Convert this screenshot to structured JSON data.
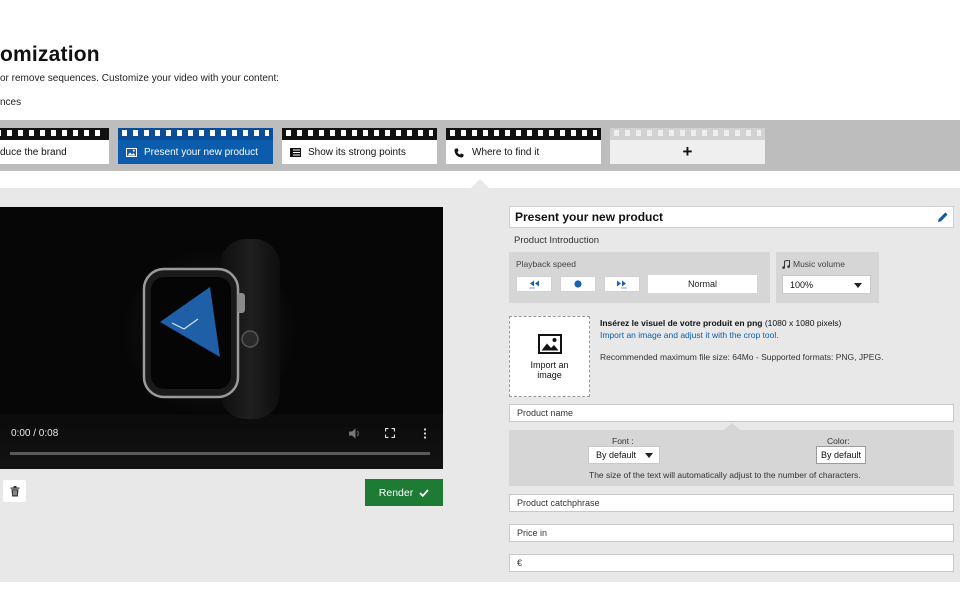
{
  "header": {
    "title": "omization",
    "subtitle": "or remove sequences. Customize your video with your content:",
    "section_label": "nces"
  },
  "sequences": [
    {
      "label": "duce the brand",
      "icon": "none",
      "active": false
    },
    {
      "label": "Present your new product",
      "icon": "image-icon",
      "active": true
    },
    {
      "label": "Show its strong points",
      "icon": "list-icon",
      "active": false
    },
    {
      "label": "Where to find it",
      "icon": "phone-icon",
      "active": false
    }
  ],
  "add_sequence": {
    "label": "+"
  },
  "video": {
    "time": "0:00 / 0:08",
    "render_label": "Render"
  },
  "panel": {
    "title": "Present your new product",
    "intro_label": "Product Introduction",
    "playback_speed_label": "Playback speed",
    "playback_speed_value": "Normal",
    "music_volume_label": "Music volume",
    "music_volume_value": "100%",
    "import_label": "Import an image",
    "image_info_bold": "Insérez le visuel de votre produit en png",
    "image_info_size": " (1080 x 1080 pixels)",
    "image_info_link": "Import an image and adjust it with the crop tool.",
    "image_info_formats": "Recommended maximum file size: 64Mo - Supported formats: PNG, JPEG.",
    "product_name_placeholder": "Product name",
    "font_label": "Font :",
    "font_value": "By default",
    "color_label": "Color:",
    "color_value": "By default",
    "style_note": "The size of the text will automatically adjust to the number of characters.",
    "catchphrase_placeholder": "Product catchphrase",
    "price_placeholder": "Price in",
    "currency_placeholder": "€"
  },
  "colors": {
    "accent_blue": "#0b5cad",
    "render_green": "#1d7b34"
  }
}
